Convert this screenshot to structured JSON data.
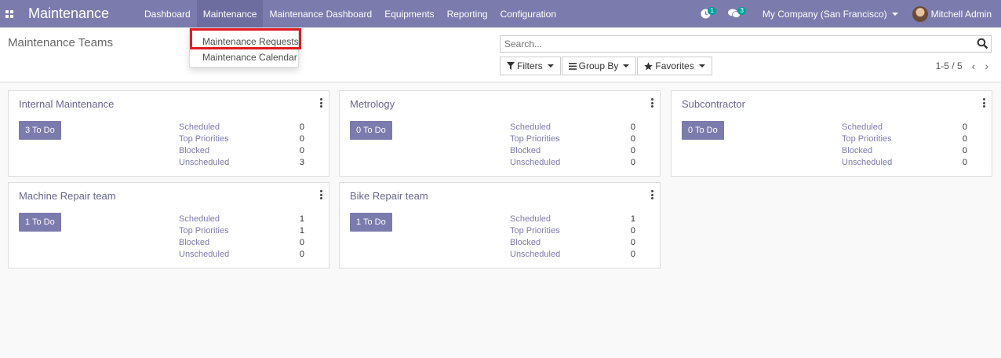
{
  "navbar": {
    "app_title": "Maintenance",
    "menu": [
      "Dashboard",
      "Maintenance",
      "Maintenance Dashboard",
      "Equipments",
      "Reporting",
      "Configuration"
    ],
    "activity_badge": "1",
    "messages_badge": "3",
    "company": "My Company (San Francisco)",
    "user": "Mitchell Admin"
  },
  "dropdown": {
    "items": [
      "Maintenance Requests",
      "Maintenance Calendar"
    ]
  },
  "control_panel": {
    "title": "Maintenance Teams",
    "search_placeholder": "Search...",
    "filters_label": "Filters",
    "group_by_label": "Group By",
    "favorites_label": "Favorites",
    "pager": "1-5 / 5"
  },
  "stat_labels": [
    "Scheduled",
    "Top Priorities",
    "Blocked",
    "Unscheduled"
  ],
  "teams": [
    {
      "name": "Internal Maintenance",
      "todo": "3 To Do",
      "values": [
        "0",
        "0",
        "0",
        "3"
      ]
    },
    {
      "name": "Metrology",
      "todo": "0 To Do",
      "values": [
        "0",
        "0",
        "0",
        "0"
      ]
    },
    {
      "name": "Subcontractor",
      "todo": "0 To Do",
      "values": [
        "0",
        "0",
        "0",
        "0"
      ]
    },
    {
      "name": "Machine Repair team",
      "todo": "1 To Do",
      "values": [
        "1",
        "1",
        "0",
        "0"
      ]
    },
    {
      "name": "Bike Repair team",
      "todo": "1 To Do",
      "values": [
        "1",
        "0",
        "0",
        "0"
      ]
    }
  ]
}
